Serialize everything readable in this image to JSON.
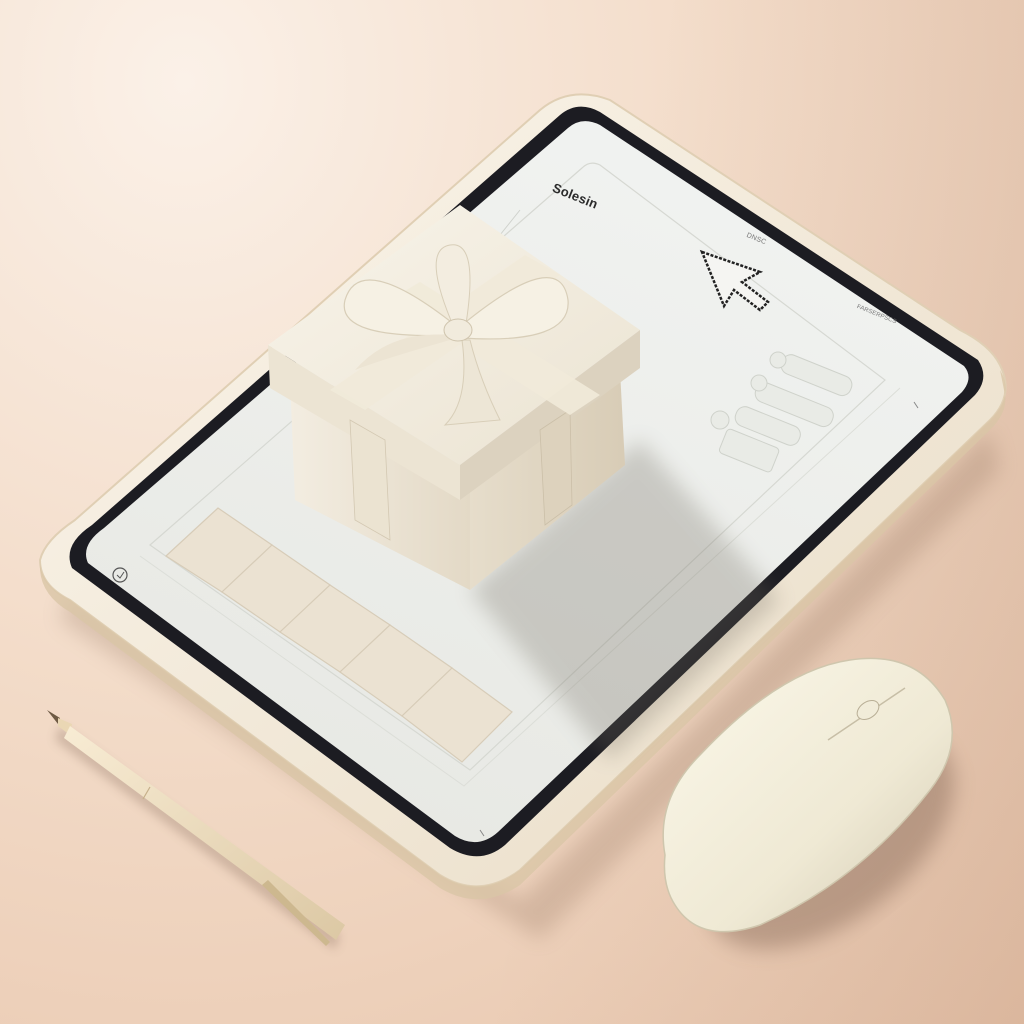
{
  "scene": {
    "brand_label": "Solesin",
    "small_label_1": "DNSC",
    "small_label_2": "FARSERPSCS"
  },
  "colors": {
    "background": "#f1d9c6",
    "tablet_frame": "#f3eadb",
    "tablet_bezel": "#1c1c22",
    "screen": "#eef0ee",
    "gift_box": "#efe8d8",
    "ribbon": "#f4efe2",
    "mouse": "#f4efdc",
    "pen": "#efe2c5"
  },
  "icons": [
    "cursor-arrow-icon",
    "gift-box-icon",
    "bow-icon",
    "mouse-icon",
    "stylus-pen-icon"
  ]
}
